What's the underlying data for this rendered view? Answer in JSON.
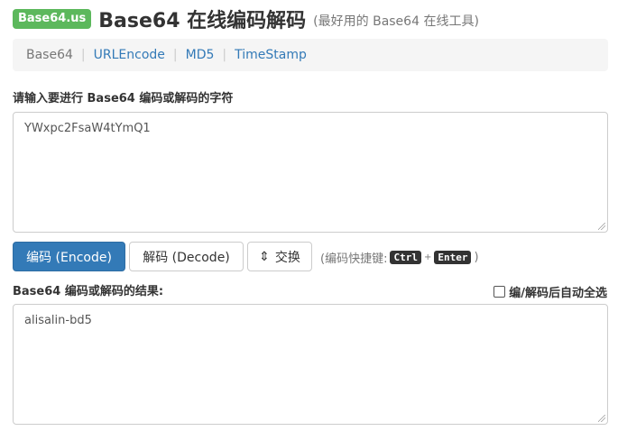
{
  "header": {
    "badge": "Base64.us",
    "title": "Base64 在线编码解码",
    "subtitle": "(最好用的 Base64 在线工具)"
  },
  "nav": {
    "items": [
      {
        "label": "Base64"
      },
      {
        "label": "URLEncode"
      },
      {
        "label": "MD5"
      },
      {
        "label": "TimeStamp"
      }
    ],
    "separator": "|"
  },
  "input": {
    "label": "请输入要进行 Base64 编码或解码的字符",
    "value": "YWxpc2FsaW4tYmQ1"
  },
  "buttons": {
    "encode": "编码 (Encode)",
    "decode": "解码 (Decode)",
    "swap": "交换",
    "swap_icon": "⇕"
  },
  "shortcut": {
    "prefix": "(编码快捷键:",
    "key1": "Ctrl",
    "plus": "+",
    "key2": "Enter",
    "suffix": ")"
  },
  "result": {
    "label": "Base64 编码或解码的结果:",
    "value": "alisalin-bd5",
    "auto_select_label": "编/解码后自动全选",
    "auto_select_checked": false
  },
  "colors": {
    "badge": "#5cb85c",
    "primary": "#337ab7",
    "link": "#337ab7"
  }
}
